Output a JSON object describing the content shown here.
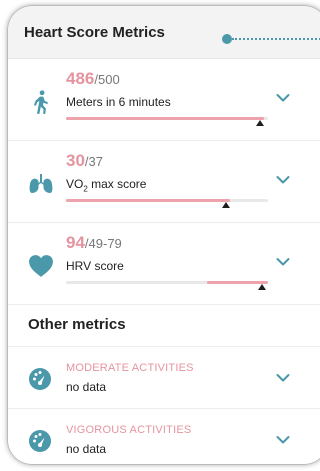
{
  "header": {
    "title": "Heart Score Metrics"
  },
  "metrics": [
    {
      "icon": "walking-person-icon",
      "value": "486",
      "target": "/500",
      "label": "Meters in 6 minutes",
      "level_fraction": 0.97,
      "fill_color": "#eea2ac"
    },
    {
      "icon": "lungs-icon",
      "value": "30",
      "target": "/37",
      "label_main": "VO",
      "label_sub": "2",
      "label_rest": " max score",
      "level_fraction": 0.81,
      "fill_color": "#eea2ac"
    },
    {
      "icon": "heart-icon",
      "value": "94",
      "target": "/49-79",
      "label": "HRV score",
      "range_fraction": [
        0.7,
        1.0
      ],
      "level_fraction": 0.98,
      "fill_color": "#eea2ac"
    }
  ],
  "other_section": {
    "title": "Other metrics",
    "items": [
      {
        "icon": "gauge-icon",
        "title": "MODERATE ACTIVITIES",
        "subtitle": "no data"
      },
      {
        "icon": "gauge-icon",
        "title": "VIGOROUS ACTIVITIES",
        "subtitle": "no data"
      }
    ]
  },
  "colors": {
    "accent": "#4a98aa",
    "value_pink": "#e5949f",
    "bar_fill": "#eea2ac"
  }
}
